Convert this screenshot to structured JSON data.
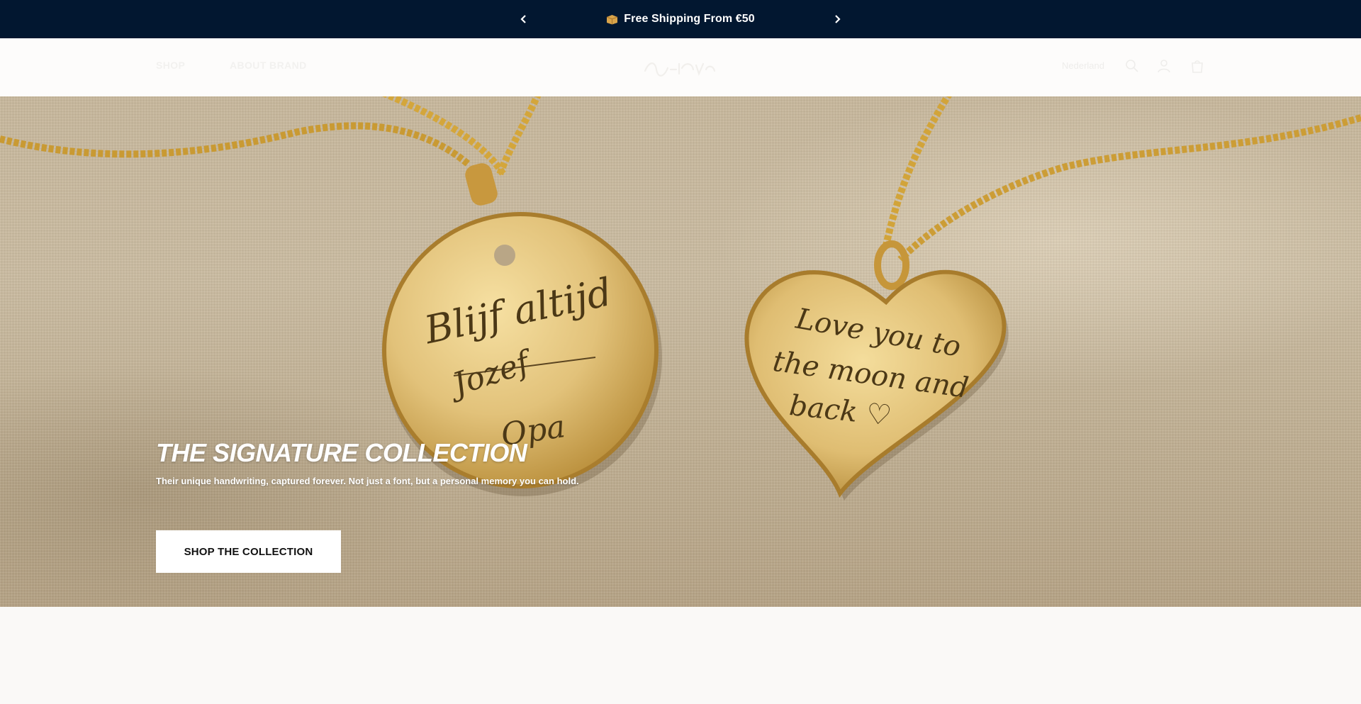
{
  "announcement": {
    "message": "Free Shipping From €50",
    "icon": "package-icon"
  },
  "header": {
    "nav": [
      {
        "label": "Shop"
      },
      {
        "label": "About Brand"
      }
    ],
    "country_label": "Nederland",
    "icons": [
      "search-icon",
      "account-icon",
      "cart-icon"
    ]
  },
  "hero": {
    "title": "THE SIGNATURE COLLECTION",
    "subtitle": "Their unique handwriting, captured forever. Not just a font, but a personal memory you can hold.",
    "cta_label": "SHOP THE COLLECTION",
    "engraving_round": [
      "Blijf altijd",
      "Jozef",
      "Opa"
    ],
    "engraving_heart": [
      "Love you to",
      "the moon and",
      "back ♡"
    ]
  },
  "colors": {
    "announcement_bg": "#021730",
    "gold": "#d9b863",
    "linen": "#c8b89c"
  }
}
